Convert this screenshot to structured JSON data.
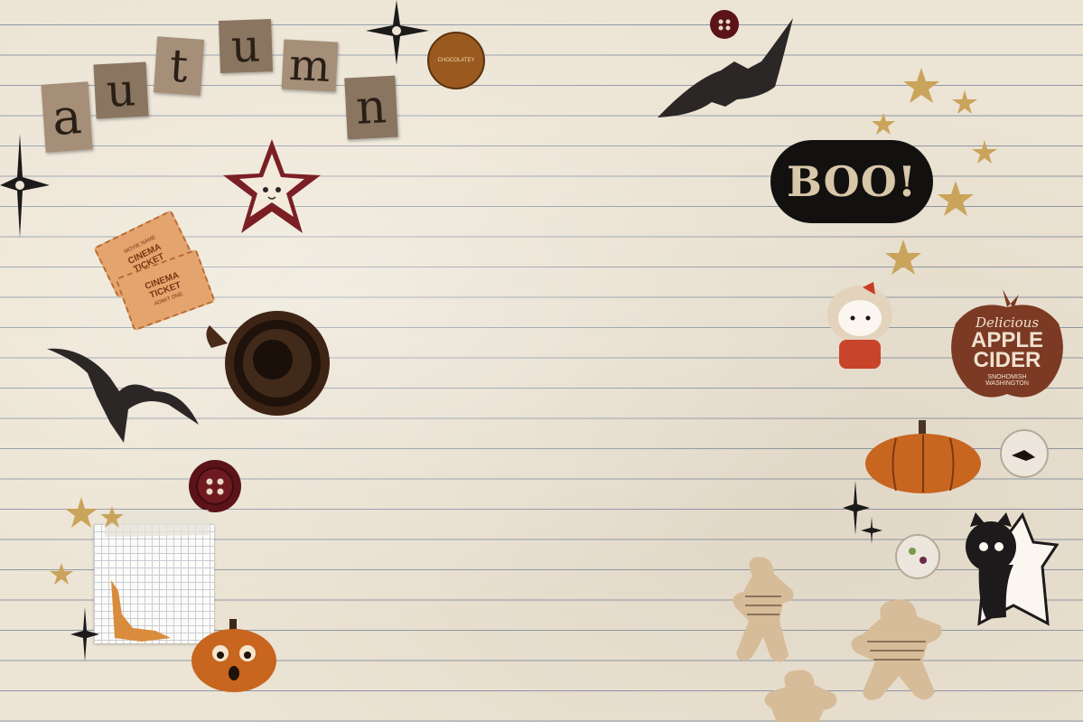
{
  "stickers": {
    "autumn_letters": [
      "a",
      "u",
      "t",
      "u",
      "m",
      "n"
    ],
    "boo": "BOO!",
    "badge": {
      "top": "",
      "main": "CHOCOLATEY"
    },
    "tickets": {
      "line1": "CINEMA",
      "line2": "TICKET",
      "top_small": "MOVIE NAME",
      "bottom_small": "ADMIT ONE"
    },
    "apple_cider": {
      "script": "Delicious",
      "line1": "APPLE",
      "line2": "CIDER",
      "line3": "SNOHOMISH",
      "line4": "WASHINGTON"
    }
  },
  "colors": {
    "paper": "#ece4d4",
    "rule_line": "#8f98a6",
    "pumpkin": "#c8651f",
    "apple": "#7c3a24",
    "button": "#5a1419",
    "star_gold": "#c9a45a",
    "bat": "#2b2727"
  }
}
